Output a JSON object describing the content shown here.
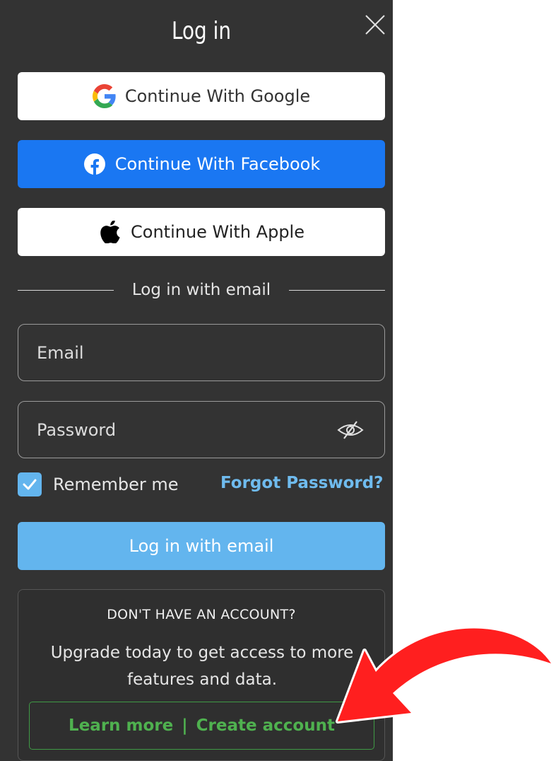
{
  "dialog": {
    "title": "Log in",
    "close_icon": "close-icon"
  },
  "social": {
    "google_label": "Continue With Google",
    "facebook_label": "Continue With Facebook",
    "apple_label": "Continue With Apple"
  },
  "divider_text": "Log in with email",
  "form": {
    "email_placeholder": "Email",
    "password_placeholder": "Password",
    "remember_label": "Remember me",
    "remember_checked": true,
    "forgot_label": "Forgot Password?",
    "submit_label": "Log in with email"
  },
  "promo": {
    "heading": "DON'T HAVE AN ACCOUNT?",
    "body": "Upgrade today to get access to more features and data.",
    "learn_more": "Learn more",
    "separator": "|",
    "create_account": "Create account"
  },
  "colors": {
    "panel_bg": "#333333",
    "facebook_blue": "#1a77f2",
    "accent_blue": "#63b5ee",
    "link_blue": "#6fbbee",
    "promo_green": "#4fb14f",
    "annotation_red": "#ff1f1f"
  }
}
